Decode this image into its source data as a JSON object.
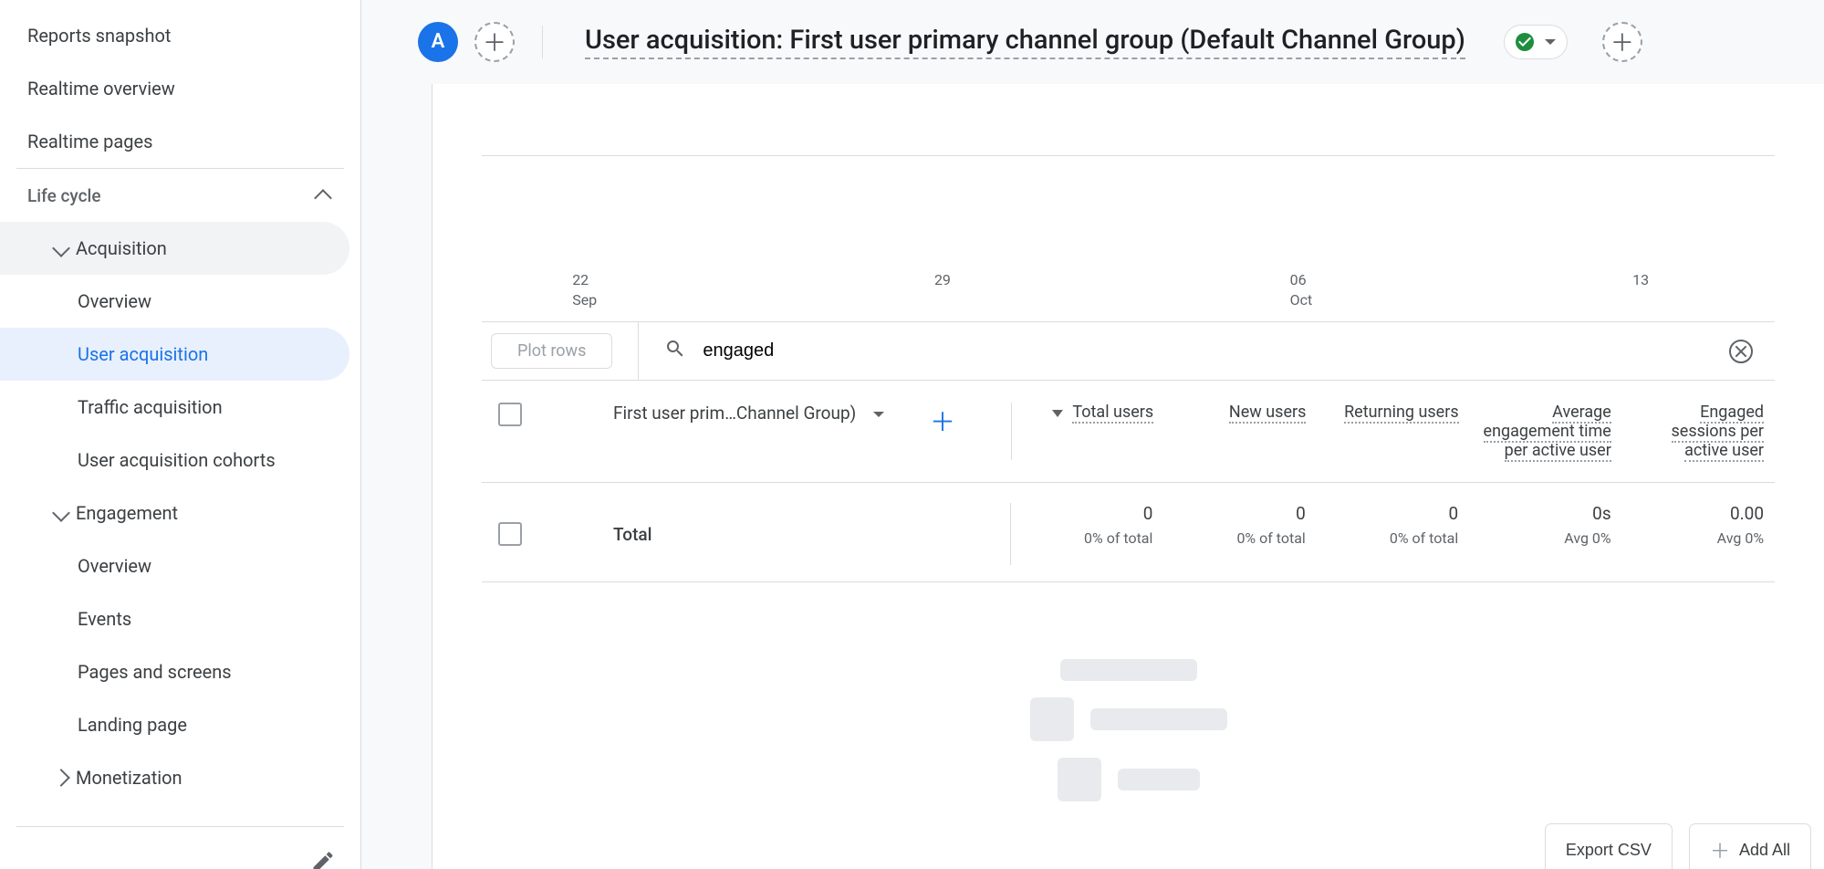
{
  "header": {
    "avatar_letter": "A",
    "title": "User acquisition: First user primary channel group (Default Channel Group)"
  },
  "sidebar": {
    "reports_snapshot": "Reports snapshot",
    "realtime_overview": "Realtime overview",
    "realtime_pages": "Realtime pages",
    "life_cycle": "Life cycle",
    "acquisition": "Acquisition",
    "acq_overview": "Overview",
    "user_acq": "User acquisition",
    "traffic_acq": "Traffic acquisition",
    "user_acq_cohorts": "User acquisition cohorts",
    "engagement": "Engagement",
    "eng_overview": "Overview",
    "events": "Events",
    "pages_screens": "Pages and screens",
    "landing_page": "Landing page",
    "monetization": "Monetization"
  },
  "chart_data": {
    "type": "line",
    "x_ticks": [
      {
        "label_top": "22",
        "label_bottom": "Sep",
        "pos_pct": 7
      },
      {
        "label_top": "29",
        "label_bottom": "",
        "pos_pct": 35
      },
      {
        "label_top": "06",
        "label_bottom": "Oct",
        "pos_pct": 62.5
      },
      {
        "label_top": "13",
        "label_bottom": "",
        "pos_pct": 89
      }
    ],
    "series": [],
    "ylim": null
  },
  "tools": {
    "plot_rows": "Plot rows",
    "search_value": "engaged"
  },
  "table": {
    "dimension_label": "First user prim…Channel Group)",
    "metrics": [
      "Total users",
      "New users",
      "Returning users",
      "Average engagement time per active user",
      "Engaged sessions per active user"
    ],
    "total_label": "Total",
    "total_row": {
      "total_users": {
        "val": "0",
        "sub": "0% of total"
      },
      "new_users": {
        "val": "0",
        "sub": "0% of total"
      },
      "returning_users": {
        "val": "0",
        "sub": "0% of total"
      },
      "avg_engagement": {
        "val": "0s",
        "sub": "Avg 0%"
      },
      "engaged_sessions": {
        "val": "0.00",
        "sub": "Avg 0%"
      }
    }
  },
  "footer": {
    "export_csv": "Export CSV",
    "add_all": "Add All"
  }
}
